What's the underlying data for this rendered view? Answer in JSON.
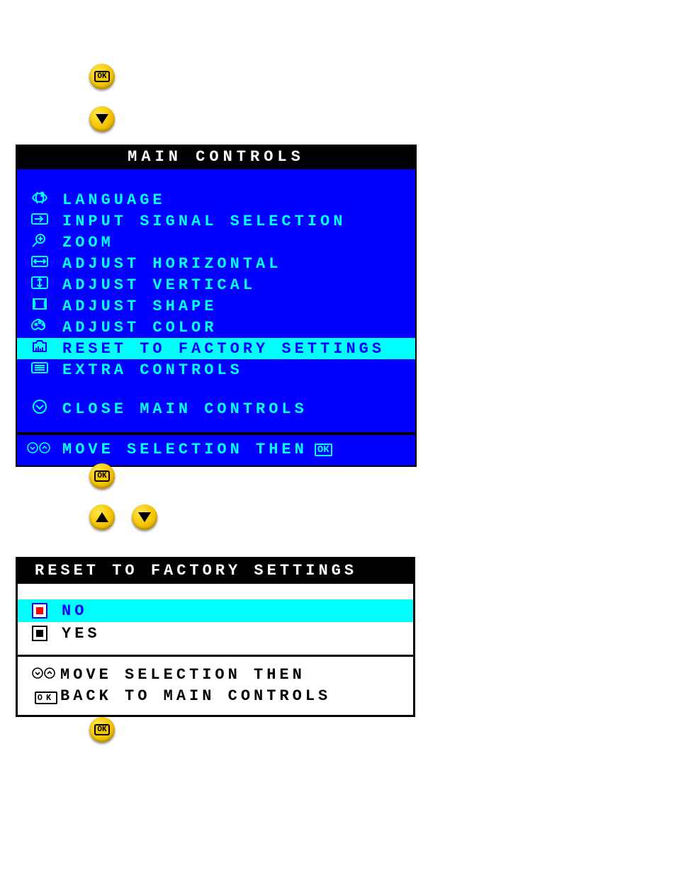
{
  "buttons": {
    "ok_glyph": "OK"
  },
  "osd1": {
    "title": "MAIN CONTROLS",
    "items": [
      {
        "icon": "language-icon",
        "label": "LANGUAGE"
      },
      {
        "icon": "input-icon",
        "label": "INPUT SIGNAL SELECTION"
      },
      {
        "icon": "zoom-icon",
        "label": "ZOOM"
      },
      {
        "icon": "horiz-icon",
        "label": "ADJUST HORIZONTAL"
      },
      {
        "icon": "vert-icon",
        "label": "ADJUST VERTICAL"
      },
      {
        "icon": "shape-icon",
        "label": "ADJUST SHAPE"
      },
      {
        "icon": "color-icon",
        "label": "ADJUST COLOR"
      },
      {
        "icon": "reset-icon",
        "label": "RESET TO FACTORY SETTINGS",
        "selected": true
      },
      {
        "icon": "extra-icon",
        "label": "EXTRA CONTROLS"
      }
    ],
    "close_label": "CLOSE MAIN CONTROLS",
    "footer_text": "MOVE SELECTION THEN",
    "footer_ok": "OK"
  },
  "osd2": {
    "title": "RESET TO FACTORY SETTINGS",
    "options": [
      {
        "label": "NO",
        "selected": true
      },
      {
        "label": "YES",
        "selected": false
      }
    ],
    "footer_line1": "MOVE SELECTION THEN",
    "footer_line2": "BACK TO MAIN CONTROLS",
    "footer_ok": "OK"
  }
}
